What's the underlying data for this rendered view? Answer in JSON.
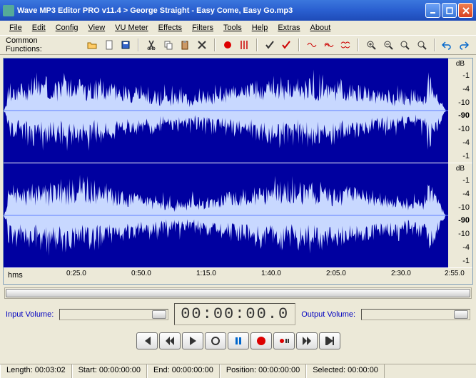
{
  "window_title": "Wave MP3 Editor PRO v11.4 > George Straight - Easy Come, Easy Go.mp3",
  "menus": [
    "File",
    "Edit",
    "Config",
    "View",
    "VU Meter",
    "Effects",
    "Filters",
    "Tools",
    "Help",
    "Extras",
    "About"
  ],
  "toolbar_label": "Common Functions:",
  "db_header": "dB",
  "db_scale_upper": [
    "-1",
    "-4",
    "-10",
    "-90"
  ],
  "db_scale_lower": [
    "-10",
    "-4",
    "-1"
  ],
  "ruler_label": "hms",
  "ruler_ticks": [
    {
      "pos": 88,
      "label": "0:25.0"
    },
    {
      "pos": 179,
      "label": "0:50.0"
    },
    {
      "pos": 270,
      "label": "1:15.0"
    },
    {
      "pos": 361,
      "label": "1:40.0"
    },
    {
      "pos": 452,
      "label": "2:05.0"
    },
    {
      "pos": 543,
      "label": "2:30.0"
    },
    {
      "pos": 618,
      "label": "2:55.0"
    }
  ],
  "input_volume_label": "Input Volume:",
  "output_volume_label": "Output Volume:",
  "lcd_time": "00:00:00.0",
  "status": {
    "length": "Length: 00:03:02",
    "start": "Start: 00:00:00:00",
    "end": "End: 00:00:00:00",
    "position": "Position: 00:00:00:00",
    "selected": "Selected: 00:00:00"
  },
  "toolbar_icons": [
    "open",
    "new",
    "save",
    "cut",
    "copy",
    "paste",
    "delete",
    "record",
    "markers",
    "check",
    "uncheck",
    "fade1",
    "fade2",
    "fade3",
    "zoom-in",
    "zoom-out",
    "zoom-sel",
    "zoom-fit",
    "undo",
    "redo"
  ],
  "transport": [
    "skip-start",
    "rewind",
    "play",
    "stop",
    "pause",
    "record",
    "record-pause",
    "forward",
    "skip-end"
  ]
}
